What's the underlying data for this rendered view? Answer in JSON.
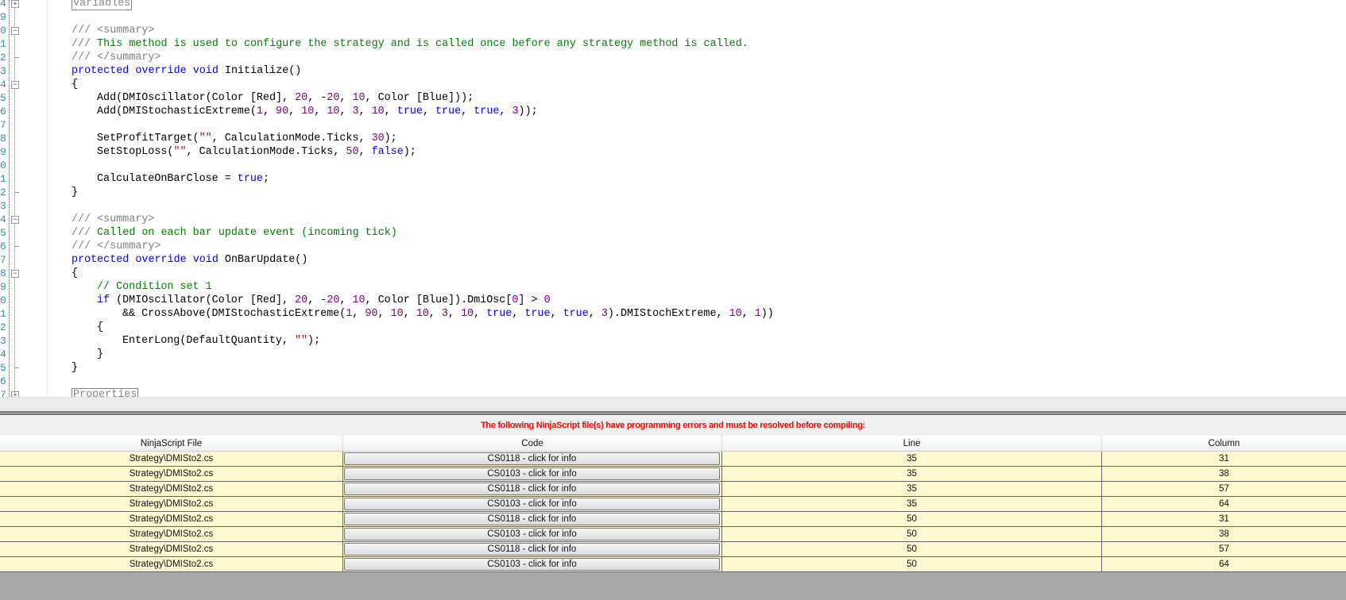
{
  "editor": {
    "lines": [
      {
        "n": "4",
        "fold": "plus",
        "html": "<span class='region'>Variables</span>",
        "indent": 0
      },
      {
        "n": "9",
        "html": "",
        "indent": 0
      },
      {
        "n": "0",
        "fold": "minus",
        "html": "<span class='xd'>/// &lt;summary&gt;</span>",
        "indent": 0
      },
      {
        "n": "1",
        "html": "<span class='xd'>///</span><span class='cm'> This method is used to configure the strategy and is called once before any strategy method is called.</span>",
        "indent": 0
      },
      {
        "n": "2",
        "fold": "end",
        "html": "<span class='xd'>/// &lt;/summary&gt;</span>",
        "indent": 0
      },
      {
        "n": "3",
        "html": "<span class='kw'>protected</span> <span class='kw'>override</span> <span class='kw'>void</span> Initialize()",
        "indent": 0
      },
      {
        "n": "4",
        "fold": "minus",
        "html": "{",
        "indent": 0
      },
      {
        "n": "5",
        "html": "Add(DMIOscillator(Color [Red], <span class='num'>20</span>, -<span class='num'>20</span>, <span class='num'>10</span>, Color [Blue]));",
        "indent": 1
      },
      {
        "n": "6",
        "html": "Add(DMIStochasticExtreme(<span class='num'>1</span>, <span class='num'>90</span>, <span class='num'>10</span>, <span class='num'>10</span>, <span class='num'>3</span>, <span class='num'>10</span>, <span class='kw'>true</span>, <span class='kw'>true</span>, <span class='kw'>true</span>, <span class='num'>3</span>));",
        "indent": 1
      },
      {
        "n": "7",
        "html": "",
        "indent": 0
      },
      {
        "n": "8",
        "html": "SetProfitTarget(<span class='str'>\"\"</span>, CalculationMode.Ticks, <span class='num'>30</span>);",
        "indent": 1
      },
      {
        "n": "9",
        "html": "SetStopLoss(<span class='str'>\"\"</span>, CalculationMode.Ticks, <span class='num'>50</span>, <span class='kw'>false</span>);",
        "indent": 1
      },
      {
        "n": "0",
        "html": "",
        "indent": 0
      },
      {
        "n": "1",
        "html": "CalculateOnBarClose = <span class='kw'>true</span>;",
        "indent": 1
      },
      {
        "n": "2",
        "fold": "end",
        "html": "}",
        "indent": 0
      },
      {
        "n": "3",
        "html": "",
        "indent": 0
      },
      {
        "n": "4",
        "fold": "minus",
        "html": "<span class='xd'>/// &lt;summary&gt;</span>",
        "indent": 0
      },
      {
        "n": "5",
        "html": "<span class='xd'>///</span><span class='cm'> Called on each bar update event (incoming tick)</span>",
        "indent": 0
      },
      {
        "n": "6",
        "fold": "end",
        "html": "<span class='xd'>/// &lt;/summary&gt;</span>",
        "indent": 0
      },
      {
        "n": "7",
        "html": "<span class='kw'>protected</span> <span class='kw'>override</span> <span class='kw'>void</span> OnBarUpdate()",
        "indent": 0
      },
      {
        "n": "8",
        "fold": "minus",
        "html": "{",
        "indent": 0
      },
      {
        "n": "9",
        "html": "<span class='cm'>// Condition set 1</span>",
        "indent": 1
      },
      {
        "n": "0",
        "html": "<span class='kw'>if</span> (DMIOscillator(Color [Red], <span class='num'>20</span>, -<span class='num'>20</span>, <span class='num'>10</span>, Color [Blue]).DmiOsc[<span class='num'>0</span>] &gt; <span class='num'>0</span>",
        "indent": 1
      },
      {
        "n": "1",
        "html": "&amp;&amp; CrossAbove(DMIStochasticExtreme(<span class='num'>1</span>, <span class='num'>90</span>, <span class='num'>10</span>, <span class='num'>10</span>, <span class='num'>3</span>, <span class='num'>10</span>, <span class='kw'>true</span>, <span class='kw'>true</span>, <span class='kw'>true</span>, <span class='num'>3</span>).DMIStochExtreme, <span class='num'>10</span>, <span class='num'>1</span>))",
        "indent": 2
      },
      {
        "n": "2",
        "html": "{",
        "indent": 1
      },
      {
        "n": "3",
        "html": "EnterLong(DefaultQuantity, <span class='str'>\"\"</span>);",
        "indent": 2
      },
      {
        "n": "4",
        "html": "}",
        "indent": 1
      },
      {
        "n": "5",
        "fold": "end",
        "html": "}",
        "indent": 0
      },
      {
        "n": "6",
        "html": "",
        "indent": 0
      },
      {
        "n": "7",
        "fold": "plus",
        "html": "<span class='region'>Properties</span>",
        "indent": 0
      }
    ]
  },
  "errors": {
    "message": "The following NinjaScript file(s) have programming errors and must be resolved before compiling:",
    "columns": [
      "NinjaScript File",
      "Code",
      "Line",
      "Column"
    ],
    "rows": [
      {
        "file": "Strategy\\DMISto2.cs",
        "code": "CS0118 - click for info",
        "line": "35",
        "column": "31"
      },
      {
        "file": "Strategy\\DMISto2.cs",
        "code": "CS0103 - click for info",
        "line": "35",
        "column": "38"
      },
      {
        "file": "Strategy\\DMISto2.cs",
        "code": "CS0118 - click for info",
        "line": "35",
        "column": "57"
      },
      {
        "file": "Strategy\\DMISto2.cs",
        "code": "CS0103 - click for info",
        "line": "35",
        "column": "64"
      },
      {
        "file": "Strategy\\DMISto2.cs",
        "code": "CS0118 - click for info",
        "line": "50",
        "column": "31"
      },
      {
        "file": "Strategy\\DMISto2.cs",
        "code": "CS0103 - click for info",
        "line": "50",
        "column": "38"
      },
      {
        "file": "Strategy\\DMISto2.cs",
        "code": "CS0118 - click for info",
        "line": "50",
        "column": "57"
      },
      {
        "file": "Strategy\\DMISto2.cs",
        "code": "CS0103 - click for info",
        "line": "50",
        "column": "64"
      }
    ]
  }
}
